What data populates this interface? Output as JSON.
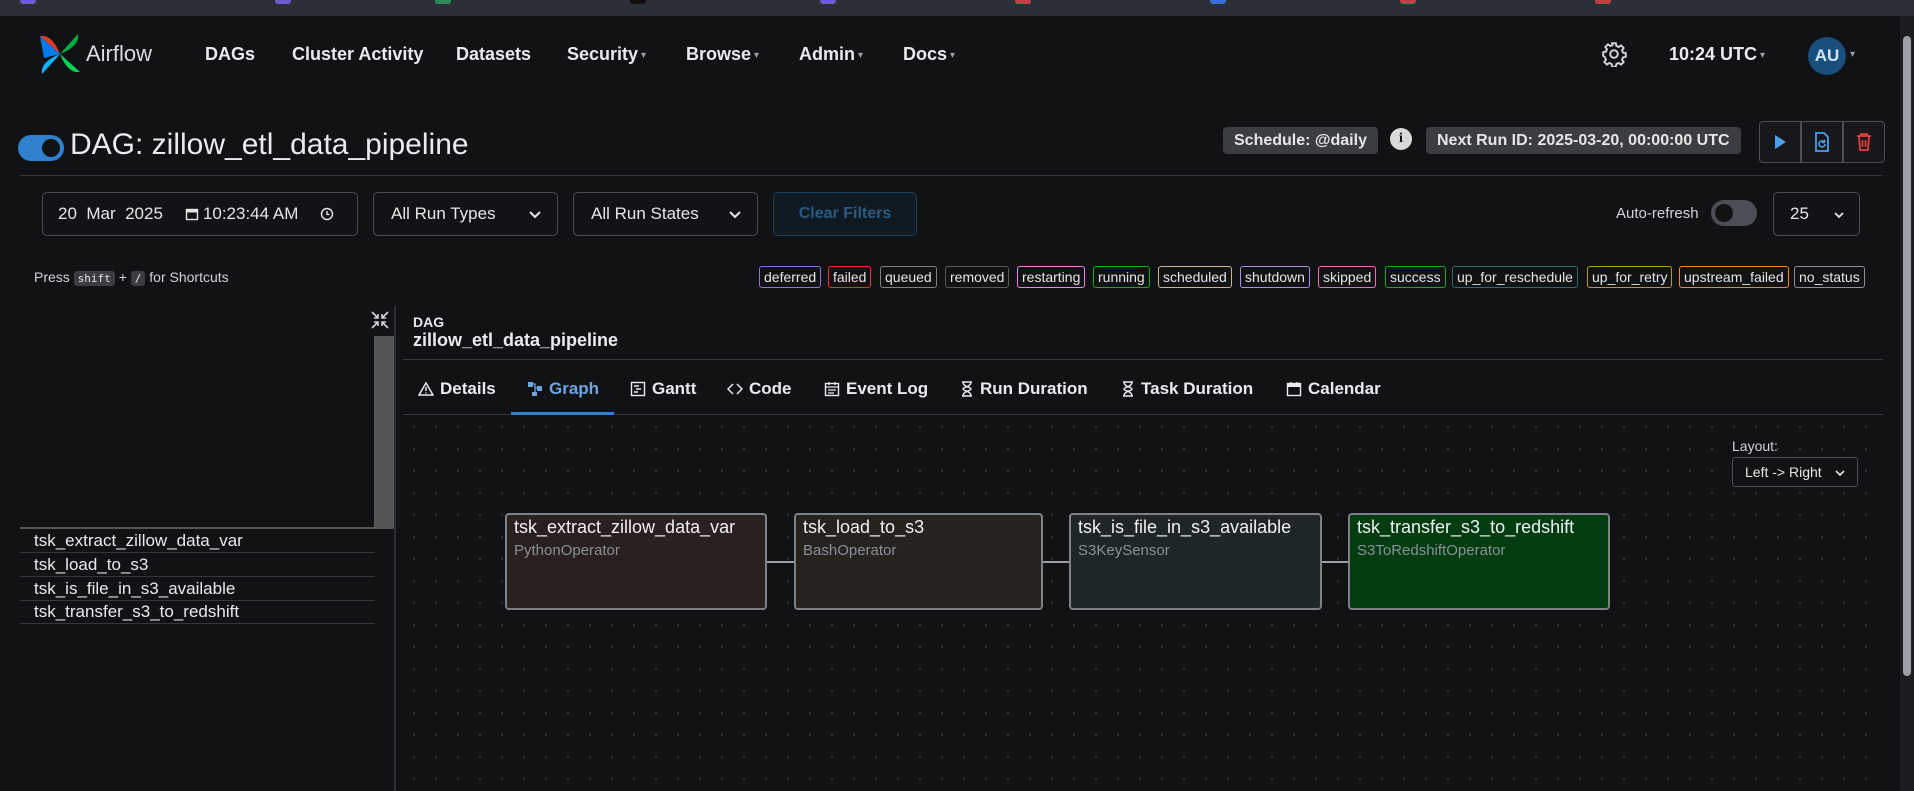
{
  "nav": {
    "brand": "Airflow",
    "items": [
      {
        "label": "DAGs",
        "dropdown": false
      },
      {
        "label": "Cluster Activity",
        "dropdown": false
      },
      {
        "label": "Datasets",
        "dropdown": false
      },
      {
        "label": "Security",
        "dropdown": true
      },
      {
        "label": "Browse",
        "dropdown": true
      },
      {
        "label": "Admin",
        "dropdown": true
      },
      {
        "label": "Docs",
        "dropdown": true
      }
    ],
    "time": "10:24 UTC",
    "user_initials": "AU",
    "icons": {
      "settings": "gear-icon"
    }
  },
  "dag": {
    "title": "DAG: zillow_etl_data_pipeline",
    "paused_toggle_on": true,
    "schedule": "Schedule: @daily",
    "next_run": "Next Run ID: 2025-03-20, 00:00:00 UTC",
    "actions": [
      "play-icon",
      "reparse-icon",
      "trash-icon"
    ]
  },
  "filters": {
    "date": "20  Mar  2025",
    "time": "10:23:44 AM",
    "run_types": "All Run Types",
    "run_states": "All Run States",
    "clear": "Clear Filters",
    "auto_refresh_label": "Auto-refresh",
    "page_size": "25"
  },
  "shortcuts": {
    "press": "Press",
    "key1": "shift",
    "plus": "+",
    "key2": "/",
    "suffix": "for Shortcuts"
  },
  "legend": [
    {
      "label": "deferred",
      "color": "#9370db"
    },
    {
      "label": "failed",
      "color": "#ff2a2a"
    },
    {
      "label": "queued",
      "color": "#808080"
    },
    {
      "label": "removed",
      "color": "#5a5a5a"
    },
    {
      "label": "restarting",
      "color": "#ee82ee"
    },
    {
      "label": "running",
      "color": "#18a818"
    },
    {
      "label": "scheduled",
      "color": "#d2b48c"
    },
    {
      "label": "shutdown",
      "color": "#b58ae6"
    },
    {
      "label": "skipped",
      "color": "#ff69b4"
    },
    {
      "label": "success",
      "color": "#18a818"
    },
    {
      "label": "up_for_reschedule",
      "color": "#2f6a6a"
    },
    {
      "label": "up_for_retry",
      "color": "#b8a000"
    },
    {
      "label": "upstream_failed",
      "color": "#ff8c00"
    },
    {
      "label": "no_status",
      "color": "#8a8f96"
    }
  ],
  "tasks": [
    "tsk_extract_zillow_data_var",
    "tsk_load_to_s3",
    "tsk_is_file_in_s3_available",
    "tsk_transfer_s3_to_redshift"
  ],
  "details": {
    "dag_label": "DAG",
    "dag_name": "zillow_etl_data_pipeline",
    "tabs": [
      {
        "label": "Details",
        "icon": "warning-icon"
      },
      {
        "label": "Graph",
        "icon": "graph-icon",
        "active": true
      },
      {
        "label": "Gantt",
        "icon": "gantt-icon"
      },
      {
        "label": "Code",
        "icon": "code-icon"
      },
      {
        "label": "Event Log",
        "icon": "calendar-log-icon"
      },
      {
        "label": "Run Duration",
        "icon": "hourglass-icon"
      },
      {
        "label": "Task Duration",
        "icon": "hourglass-icon"
      },
      {
        "label": "Calendar",
        "icon": "calendar-icon"
      }
    ]
  },
  "graph": {
    "layout_label": "Layout:",
    "layout_value": "Left -> Right",
    "nodes": [
      {
        "title": "tsk_extract_zillow_data_var",
        "operator": "PythonOperator",
        "bg": "#2a201f"
      },
      {
        "title": "tsk_load_to_s3",
        "operator": "BashOperator",
        "bg": "#26231f"
      },
      {
        "title": "tsk_is_file_in_s3_available",
        "operator": "S3KeySensor",
        "bg": "#1f2628"
      },
      {
        "title": "tsk_transfer_s3_to_redshift",
        "operator": "S3ToRedshiftOperator",
        "bg": "#023d11"
      }
    ]
  }
}
